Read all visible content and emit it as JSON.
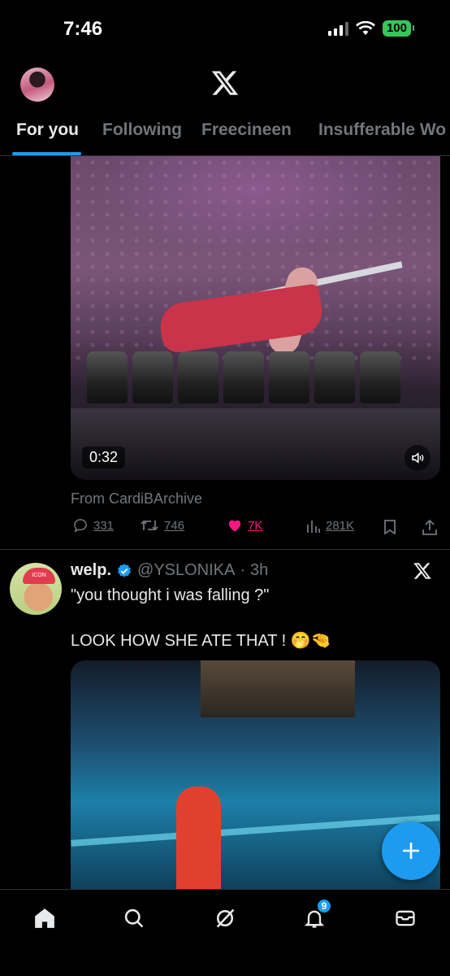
{
  "status_bar": {
    "time": "7:46",
    "battery": "100"
  },
  "tabs": [
    {
      "label": "For you",
      "active": true
    },
    {
      "label": "Following"
    },
    {
      "label": "Freecineen"
    },
    {
      "label": "Insufferable Wo"
    }
  ],
  "tweet1": {
    "video_time": "0:32",
    "source": "From CardiBArchive",
    "replies": "331",
    "reposts": "746",
    "likes": "7K",
    "views": "281K"
  },
  "tweet2": {
    "author": "welp.",
    "handle": "@YSLONIKA",
    "time": "3h",
    "text_line1": "\"you thought i was falling ?\"",
    "text_line2": "LOOK HOW SHE ATE THAT ! 🤭🤏"
  },
  "notifications_badge": "9",
  "colors": {
    "accent": "#1d9bf0",
    "like": "#f91880",
    "muted": "#71767b",
    "battery": "#34c759"
  }
}
